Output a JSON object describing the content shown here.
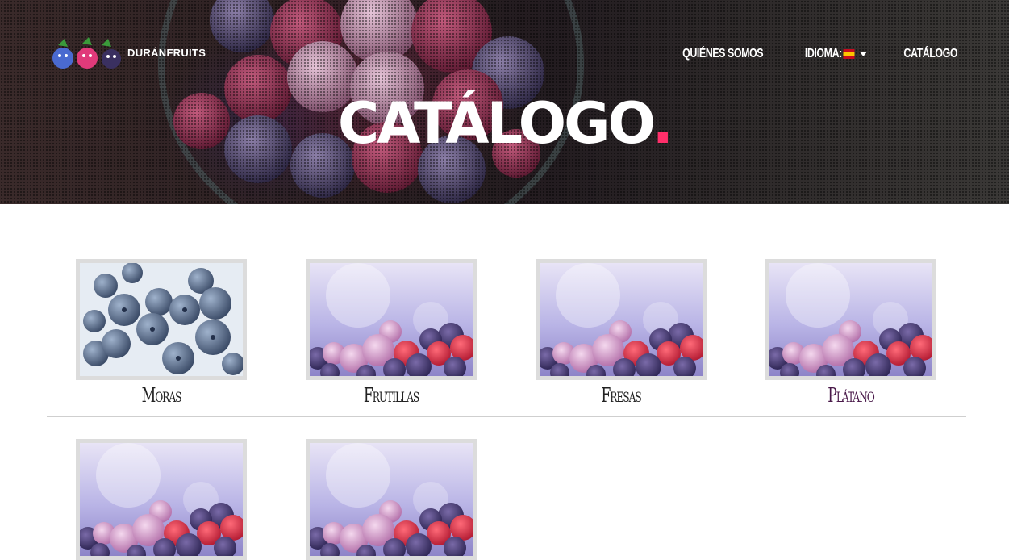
{
  "brand": {
    "name": "DURÁNFRUITS"
  },
  "nav": {
    "items": [
      {
        "label": "QUIÉNES SOMOS"
      },
      {
        "label": "IDIOMA:"
      },
      {
        "label": "CATÁLOGO"
      }
    ]
  },
  "hero": {
    "title": "CATÁLOGO",
    "dot": "."
  },
  "products": [
    {
      "label": "Moras",
      "image": "blueberries-frozen"
    },
    {
      "label": "Frutillas",
      "image": "mixed-frozen-berries"
    },
    {
      "label": "Fresas",
      "image": "mixed-frozen-berries"
    },
    {
      "label": "Plátano",
      "image": "mixed-frozen-berries"
    },
    {
      "label": "",
      "image": "mixed-frozen-berries"
    },
    {
      "label": "",
      "image": "mixed-frozen-berries"
    }
  ],
  "colors": {
    "accent_dot": "#ff2f6a",
    "card_border": "#dcdcdc",
    "hover_label": "#4a1a4a"
  }
}
